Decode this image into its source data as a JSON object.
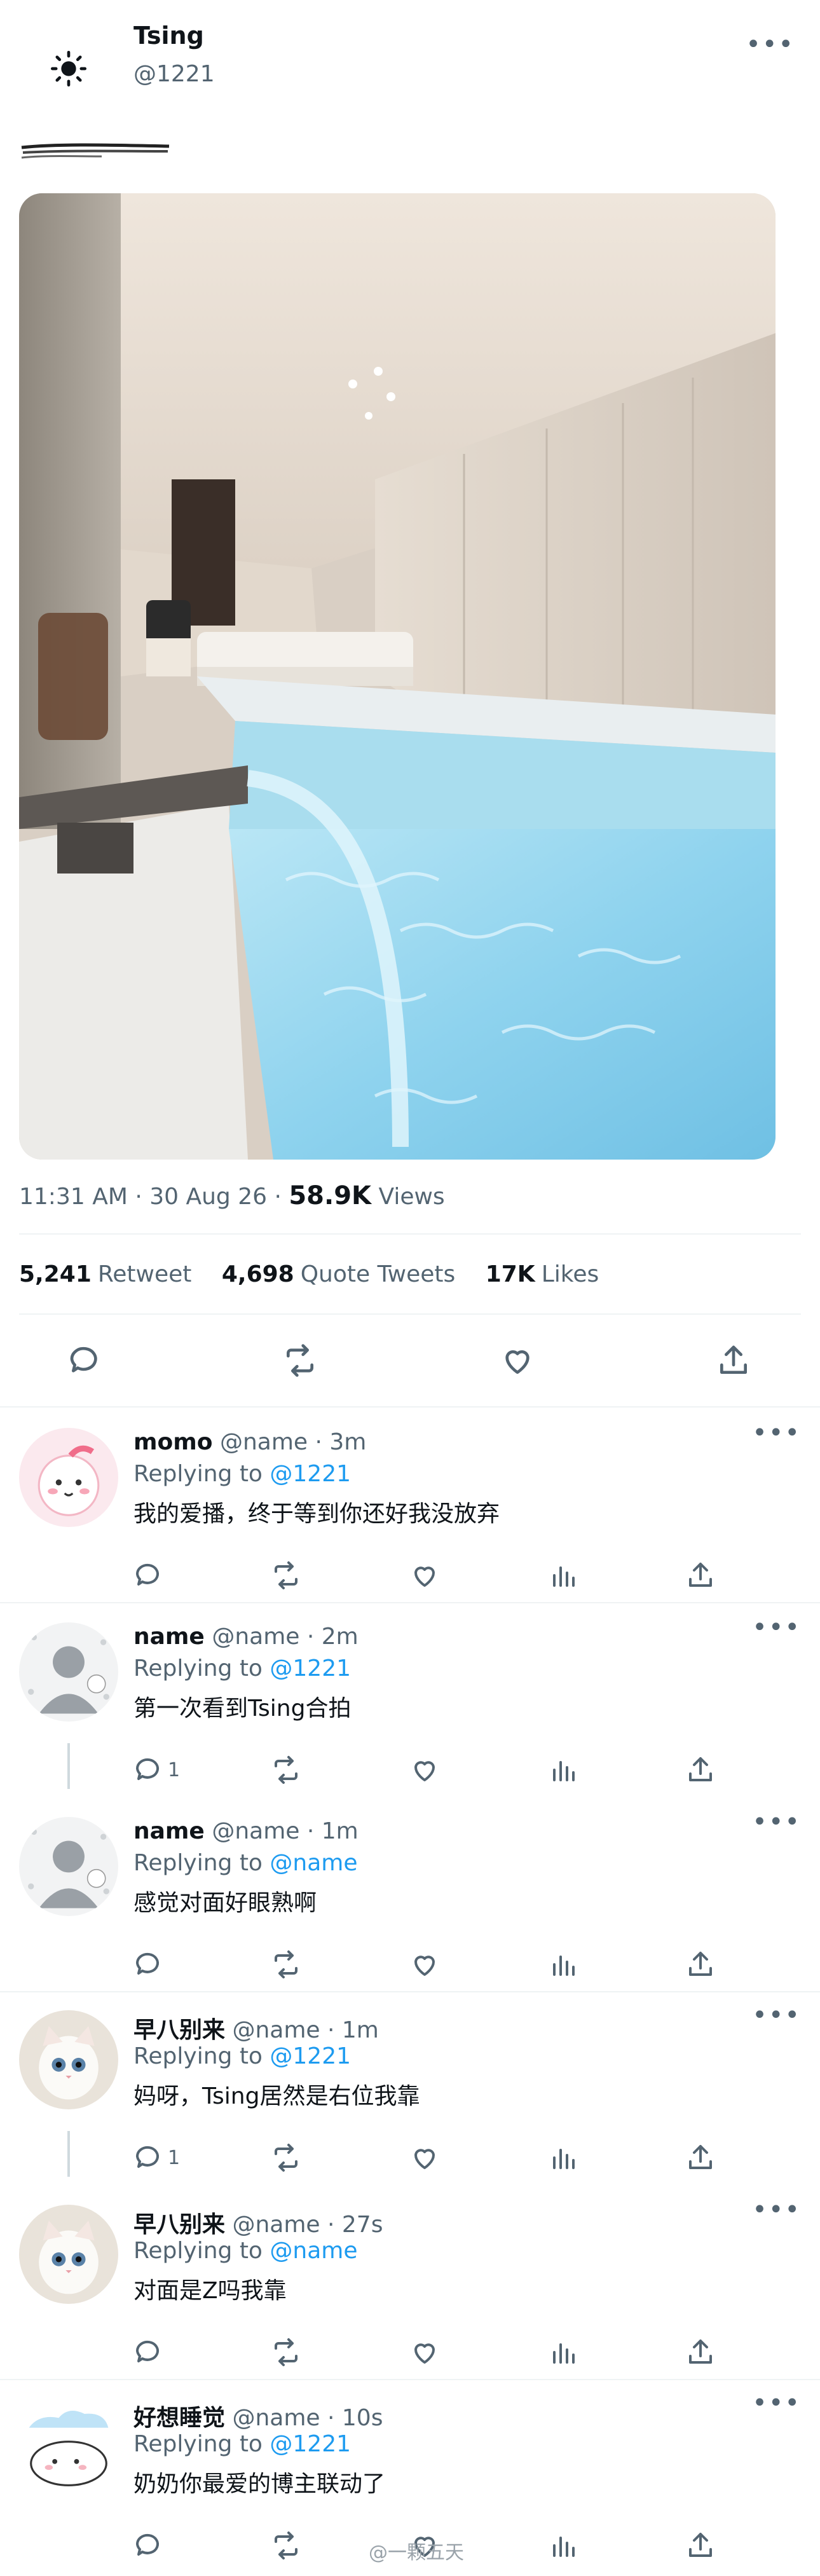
{
  "tweet": {
    "author_name": "Tsing",
    "author_handle": "@1221",
    "time": "11:31 AM · 30 Aug 26 · ",
    "views_count": "58.9K",
    "views_label": "Views",
    "stats": [
      {
        "count": "5,241",
        "label": "Retweet"
      },
      {
        "count": "4,698",
        "label": "Quote Tweets"
      },
      {
        "count": "17K",
        "label": "Likes"
      }
    ],
    "more_label": "•••"
  },
  "replies": [
    {
      "name": "momo",
      "handle": "@name",
      "time": "· 3m",
      "replying_prefix": "Replying to ",
      "replying_to": "@1221",
      "text": "我的爱播，终于等到你还好我没放弃",
      "reply_count": ""
    },
    {
      "name": "name",
      "handle": "@name",
      "time": "· 2m",
      "replying_prefix": "Replying to ",
      "replying_to": "@1221",
      "text": "第一次看到Tsing合拍",
      "reply_count": "1"
    },
    {
      "name": "name",
      "handle": "@name",
      "time": "· 1m",
      "replying_prefix": "Replying to ",
      "replying_to": "@name",
      "text": "感觉对面好眼熟啊",
      "reply_count": ""
    },
    {
      "name": "早八别来",
      "handle": "@name",
      "time": "· 1m",
      "replying_prefix": "Replying to ",
      "replying_to": "@1221",
      "text": "妈呀，Tsing居然是右位我靠",
      "reply_count": "1"
    },
    {
      "name": "早八别来",
      "handle": "@name",
      "time": "· 27s",
      "replying_prefix": "Replying to ",
      "replying_to": "@name",
      "text": "对面是Z吗我靠",
      "reply_count": ""
    },
    {
      "name": "好想睡觉",
      "handle": "@name",
      "time": "· 10s",
      "replying_prefix": "Replying to ",
      "replying_to": "@1221",
      "text": "奶奶你最爱的博主联动了",
      "reply_count": ""
    }
  ],
  "watermark": "@一颗五天",
  "colors": {
    "link": "#1d9bf0",
    "muted": "#536471",
    "water": "#8fd3ee"
  },
  "icons": [
    "sun-icon",
    "reply-icon",
    "retweet-icon",
    "like-icon",
    "share-icon",
    "views-icon",
    "more-icon"
  ]
}
